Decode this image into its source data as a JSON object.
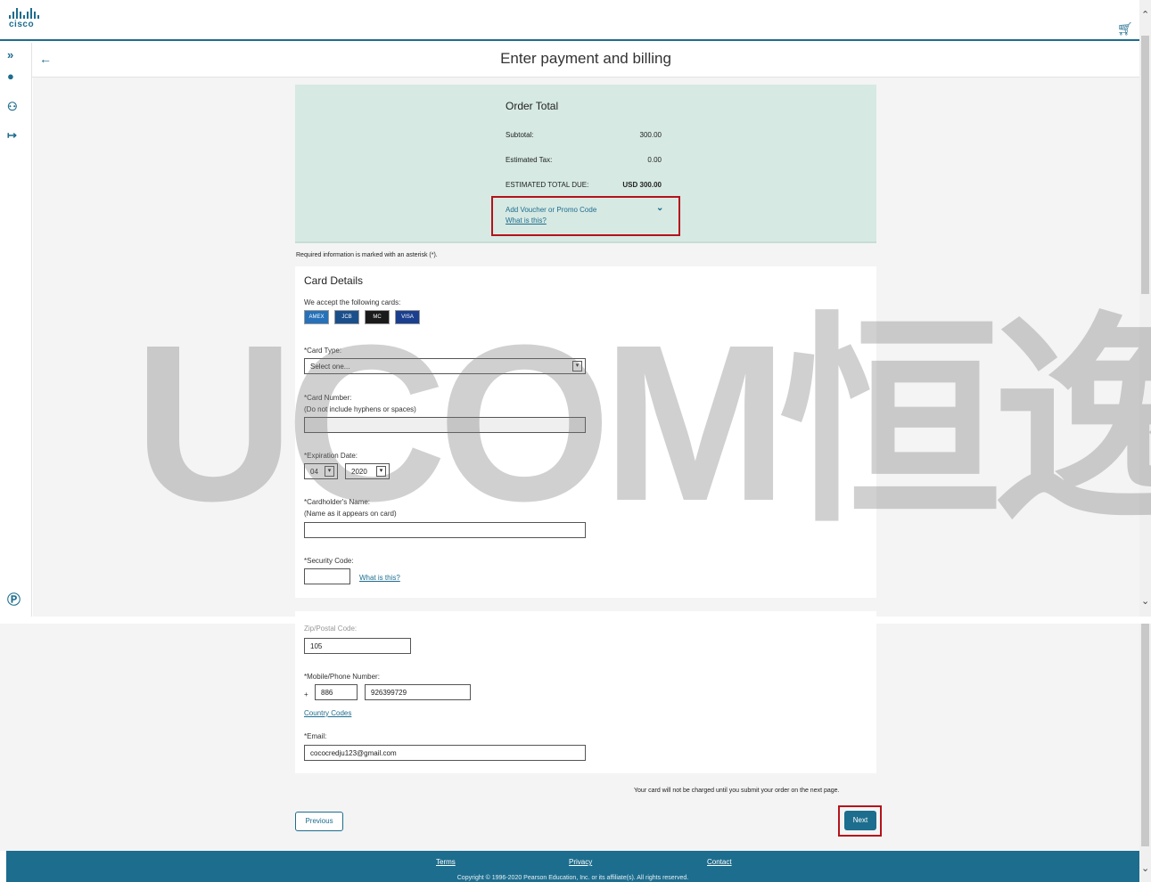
{
  "brand": {
    "logo_text": "cisco"
  },
  "page": {
    "title": "Enter payment and billing"
  },
  "order": {
    "title": "Order Total",
    "subtotal_label": "Subtotal:",
    "subtotal_value": "300.00",
    "tax_label": "Estimated Tax:",
    "tax_value": "0.00",
    "total_label": "ESTIMATED TOTAL DUE:",
    "total_value": "USD 300.00",
    "voucher_label": "Add Voucher or Promo Code",
    "voucher_help": "What is this?"
  },
  "required_note": "Required information is marked with an asterisk (*).",
  "card": {
    "heading": "Card Details",
    "accept_label": "We accept the following cards:",
    "card_logos": [
      "AMEX",
      "JCB",
      "MC",
      "VISA"
    ],
    "card_type_label": "*Card Type:",
    "card_type_value": "Select one...",
    "card_number_label": "*Card Number:",
    "card_number_hint": "(Do not include hyphens or spaces)",
    "expiration_label": "*Expiration Date:",
    "exp_month": "04",
    "exp_year": "2020",
    "holder_label": "*Cardholder's Name:",
    "holder_hint": "(Name as it appears on card)",
    "security_label": "*Security Code:",
    "security_help": "What is this?"
  },
  "address": {
    "zip_label": "Zip/Postal Code:",
    "zip_value": "105",
    "phone_label": "*Mobile/Phone Number:",
    "phone_plus": "+",
    "phone_country": "886",
    "phone_number": "926399729",
    "country_codes_link": "Country Codes",
    "email_label": "*Email:",
    "email_value": "cococredju123@gmail.com"
  },
  "charge_note": "Your card will not be charged until you submit your order on the next page.",
  "buttons": {
    "previous": "Previous",
    "next": "Next"
  },
  "footer": {
    "terms": "Terms",
    "privacy": "Privacy",
    "contact": "Contact",
    "copyright": "Copyright © 1996-2020 Pearson Education, Inc. or its affiliate(s). All rights reserved."
  },
  "watermark": "UCOM恒逸",
  "colors": {
    "brand": "#1d6d8e",
    "order_bg": "#d6e9e3",
    "highlight": "#b5121b"
  }
}
